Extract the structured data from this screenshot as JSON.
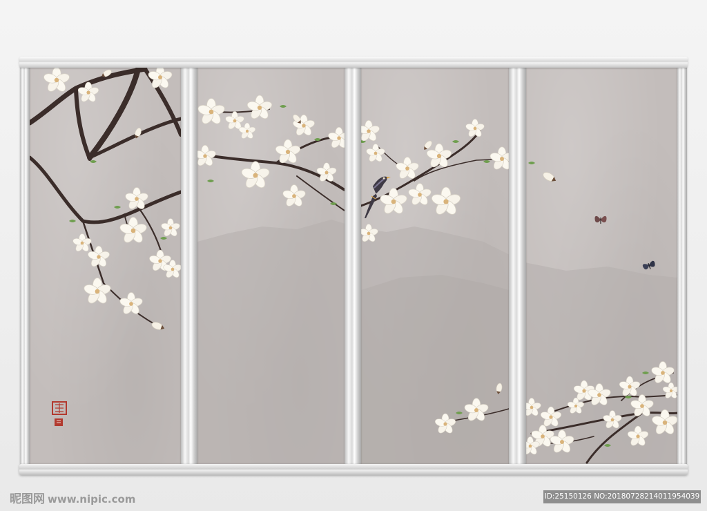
{
  "watermark": {
    "logo_text": "昵图网",
    "site_url": "www.nipic.com",
    "id_text": "ID:25150126 NO:20180728214011954039"
  },
  "colors": {
    "panel_bg": "#c3bdbb",
    "branch": "#3b2d2a",
    "blossom": "#fbf8f0",
    "blossom_center": "#d9b37a",
    "leaf": "#6f9e4f",
    "mountain": "#b5afad",
    "seal": "#b23a2f",
    "frame": "#e3e3e3"
  },
  "artwork": {
    "subject": "magnolia branches with bird and butterflies, four-panel screen",
    "panels": 4,
    "icons": [
      "bird-icon",
      "butterfly-icon",
      "seal-stamp-icon"
    ]
  }
}
